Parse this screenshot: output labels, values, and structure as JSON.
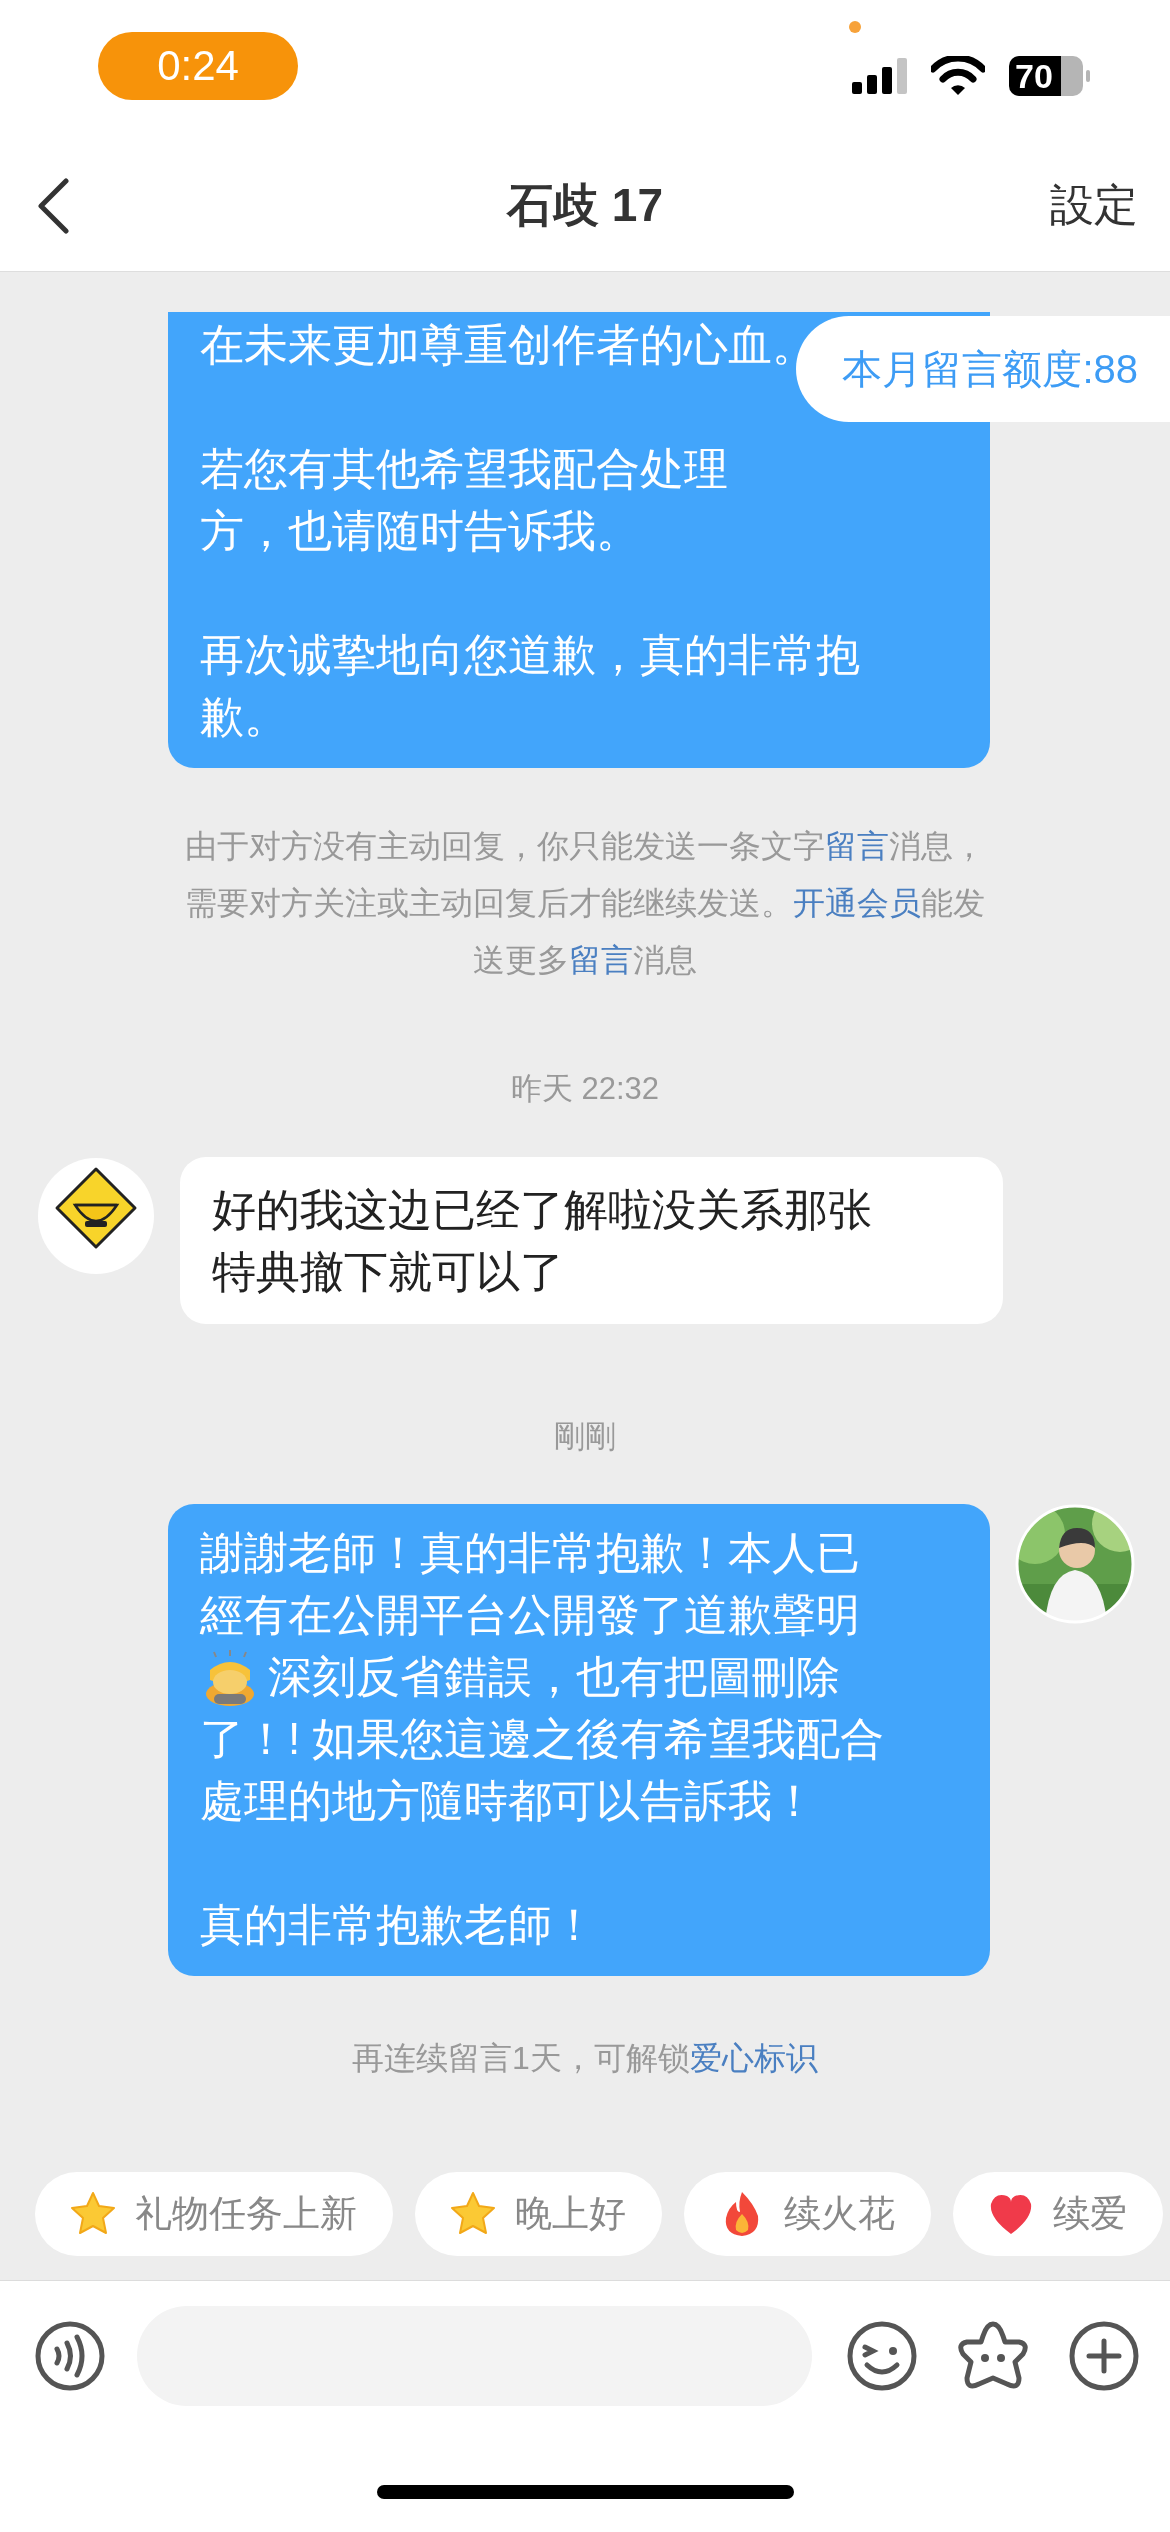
{
  "status_bar": {
    "time": "0:24",
    "battery": "70"
  },
  "header": {
    "title": "石歧 17",
    "action": "設定"
  },
  "quota_badge": "本月留言额度:88",
  "messages": [
    {
      "kind": "outgoing",
      "paragraphs": [
        [
          {
            "text": "在未来更加尊重创作者的心血。",
            "emoji": false
          }
        ],
        [
          {
            "text": "若您有其他希望我配合处理",
            "emoji": false
          },
          {
            "text": "方，也请随时告诉我。",
            "emoji": false
          }
        ],
        [
          {
            "text": "再次诚挚地向您道歉，真的非常抱",
            "emoji": false
          },
          {
            "text": "歉。",
            "emoji": false
          }
        ]
      ]
    },
    {
      "kind": "notice",
      "segments": [
        {
          "text": "由于对方没有主动回复，你只能发送一条文字",
          "link": false
        },
        {
          "text": "留言",
          "link": true
        },
        {
          "text": "消息，需要对方关注或主动回复后才能继续发送。",
          "link": false
        },
        {
          "text": "开通会员",
          "link": true
        },
        {
          "text": "能发送更多",
          "link": false
        },
        {
          "text": "留言",
          "link": true
        },
        {
          "text": "消息",
          "link": false
        }
      ]
    },
    {
      "kind": "time",
      "text": "昨天 22:32"
    },
    {
      "kind": "incoming",
      "paragraphs": [
        [
          {
            "text": "好的我这边已经了解啦没关系那张",
            "emoji": false
          },
          {
            "text": "特典撤下就可以了",
            "emoji": false
          }
        ]
      ]
    },
    {
      "kind": "time",
      "text": "剛剛"
    },
    {
      "kind": "outgoing",
      "avatar": true,
      "paragraphs": [
        [
          {
            "text": "謝謝老師！真的非常抱歉！本人已",
            "emoji": false
          },
          {
            "text": "經有在公開平台公開發了道歉聲明",
            "emoji": false
          },
          {
            "text": "深刻反省錯誤，也有把圖刪除",
            "emoji": true
          },
          {
            "text": "了！! 如果您這邊之後有希望我配合",
            "emoji": false
          },
          {
            "text": "處理的地方隨時都可以告訴我！",
            "emoji": false
          }
        ],
        [
          {
            "text": "真的非常抱歉老師！",
            "emoji": false
          }
        ]
      ]
    },
    {
      "kind": "notice",
      "segments": [
        {
          "text": "再连续留言1天，可解锁",
          "link": false
        },
        {
          "text": "爱心标识",
          "link": true
        }
      ]
    }
  ],
  "quick_replies": [
    {
      "label": "礼物任务上新",
      "kind": "star"
    },
    {
      "label": "晚上好",
      "kind": "star"
    },
    {
      "label": "续火花",
      "kind": "fire"
    },
    {
      "label": "续爱",
      "kind": "heart"
    }
  ]
}
